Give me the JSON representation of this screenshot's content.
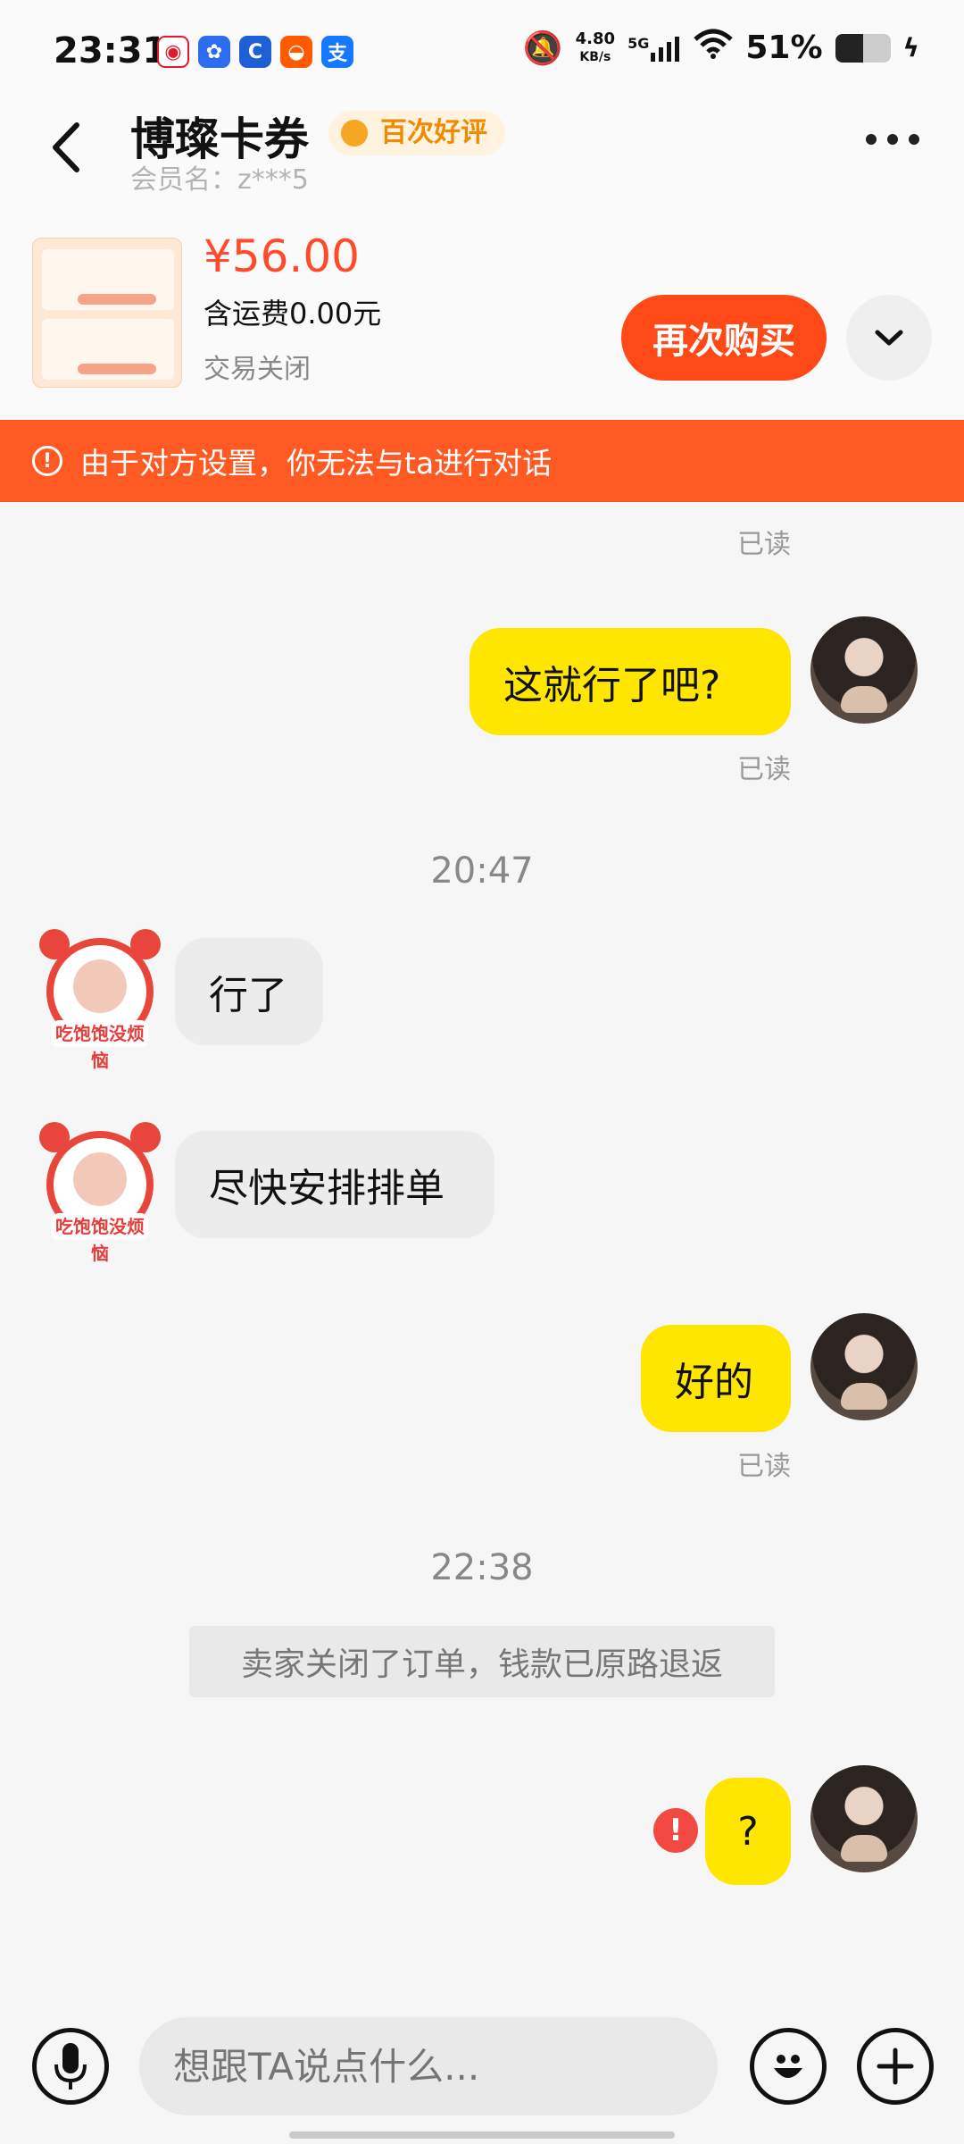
{
  "status_bar": {
    "time": "23:31",
    "net_speed_value": "4.80",
    "net_speed_unit": "KB/s",
    "signal_label": "5G",
    "battery": "51%",
    "battery_level": 0.51,
    "app_icons": [
      "weibo-icon",
      "baidu-icon",
      "app-icon",
      "taobao-icon",
      "alipay-icon"
    ]
  },
  "header": {
    "shop_name": "博璨卡券",
    "badge": "百次好评",
    "member": "会员名：z***5"
  },
  "order": {
    "price": "¥56.00",
    "shipping": "含运费0.00元",
    "status": "交易关闭",
    "rebuy_label": "再次购买"
  },
  "warning": "由于对方设置，你无法与ta进行对话",
  "messages": {
    "read_label": "已读",
    "msg1": "这就行了吧?",
    "time1": "20:47",
    "msg2": "行了",
    "msg3": "尽快安排排单",
    "msg4": "好的",
    "time2": "22:38",
    "system": "卖家关闭了订单，钱款已原路退返",
    "msg5": "?",
    "avatar_tag": "吃饱饱没烦恼"
  },
  "input": {
    "placeholder": "想跟TA说点什么..."
  },
  "colors": {
    "accent": "#ff4a17",
    "my_bubble": "#ffe600",
    "other_bubble": "#ececec",
    "warning": "#ff5a23"
  }
}
